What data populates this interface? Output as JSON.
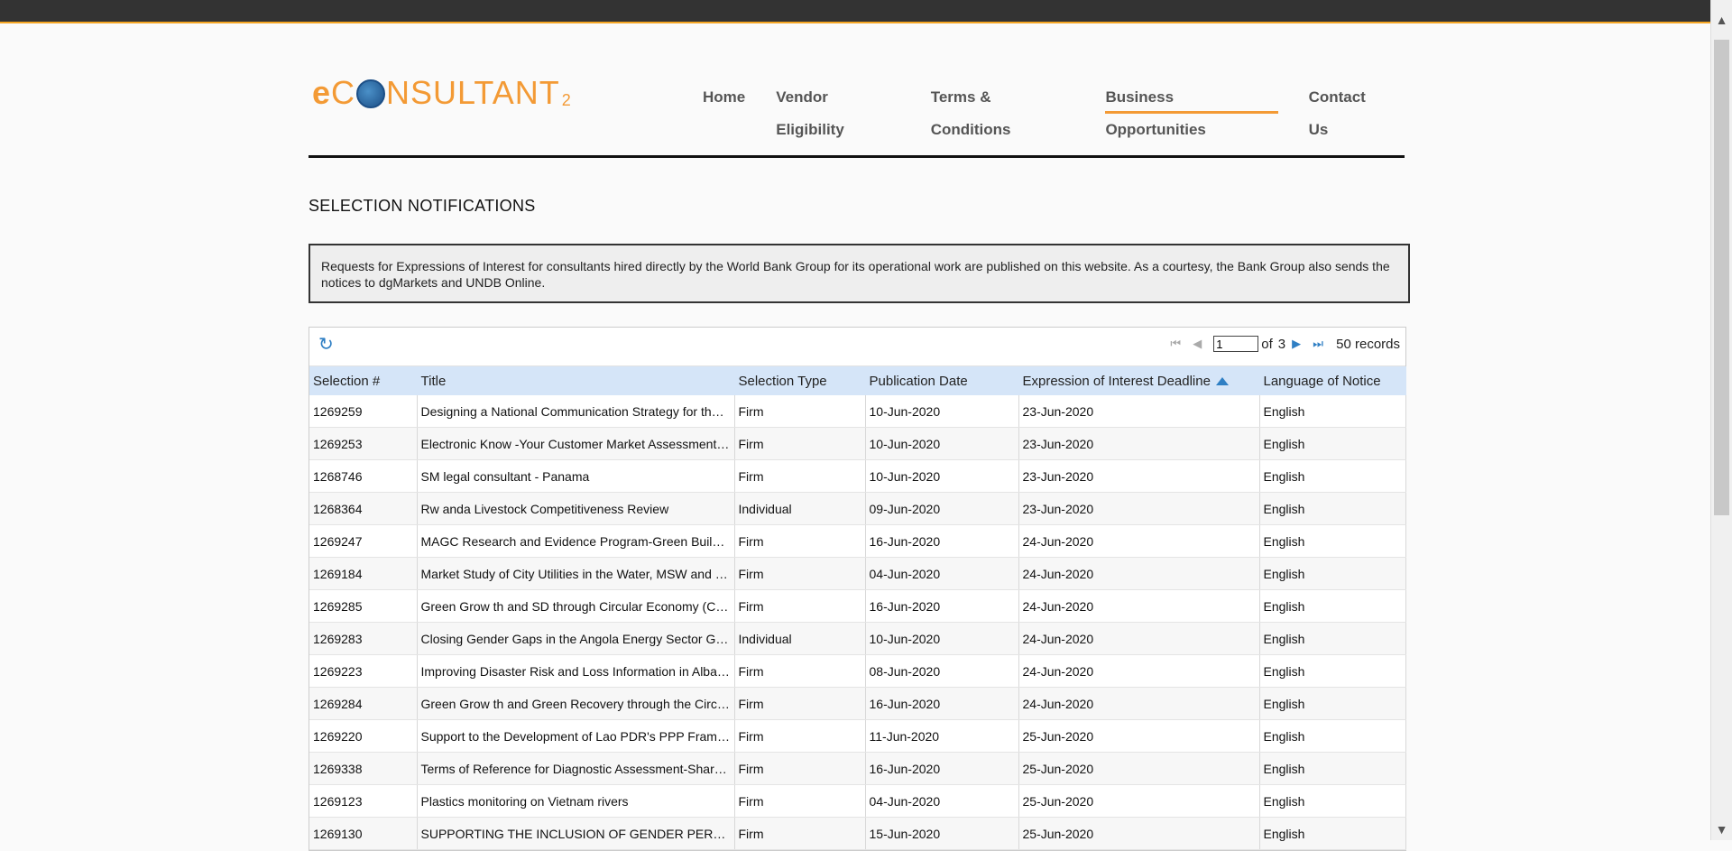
{
  "site": {
    "logo": {
      "e": "e",
      "c": "C",
      "rest": "NSULTANT",
      "sub": "2"
    }
  },
  "nav": {
    "items": [
      {
        "label": "Home"
      },
      {
        "label": "Vendor Eligibility"
      },
      {
        "label": "Terms & Conditions"
      },
      {
        "label": "Business Opportunities",
        "active": true
      },
      {
        "label": "Contact Us"
      }
    ]
  },
  "page": {
    "title": "SELECTION NOTIFICATIONS",
    "notice": "Requests for Expressions of Interest for consultants hired directly by the World Bank Group for its operational work are published on this website. As a courtesy, the Bank Group also sends the notices to dgMarkets and UNDB Online."
  },
  "pager": {
    "page_value": "1",
    "of_label": "of",
    "total_pages": "3",
    "records": "50 records"
  },
  "table": {
    "columns": [
      "Selection #",
      "Title",
      "Selection Type",
      "Publication Date",
      "Expression of Interest Deadline",
      "Language of Notice"
    ],
    "sort_column": "Expression of Interest Deadline",
    "rows": [
      [
        "1269259",
        "Designing a National Communication Strategy for the Go...",
        "Firm",
        "10-Jun-2020",
        "23-Jun-2020",
        "English"
      ],
      [
        "1269253",
        "Electronic Know -Your Customer Market Assessment - ...",
        "Firm",
        "10-Jun-2020",
        "23-Jun-2020",
        "English"
      ],
      [
        "1268746",
        "SM legal consultant - Panama",
        "Firm",
        "10-Jun-2020",
        "23-Jun-2020",
        "English"
      ],
      [
        "1268364",
        "Rw anda Livestock Competitiveness Review",
        "Individual",
        "09-Jun-2020",
        "23-Jun-2020",
        "English"
      ],
      [
        "1269247",
        "MAGC Research and Evidence Program-Green Building ...",
        "Firm",
        "16-Jun-2020",
        "24-Jun-2020",
        "English"
      ],
      [
        "1269184",
        "Market Study of City Utilities in the Water, MSW and Dist...",
        "Firm",
        "04-Jun-2020",
        "24-Jun-2020",
        "English"
      ],
      [
        "1269285",
        "Green Grow th and SD through Circular Economy (CE) i...",
        "Firm",
        "16-Jun-2020",
        "24-Jun-2020",
        "English"
      ],
      [
        "1269283",
        "Closing Gender Gaps in the Angola Energy Sector Gen...",
        "Individual",
        "10-Jun-2020",
        "24-Jun-2020",
        "English"
      ],
      [
        "1269223",
        "Improving Disaster Risk and Loss Information in Albania",
        "Firm",
        "08-Jun-2020",
        "24-Jun-2020",
        "English"
      ],
      [
        "1269284",
        "Green Grow th and Green Recovery through the Circula...",
        "Firm",
        "16-Jun-2020",
        "24-Jun-2020",
        "English"
      ],
      [
        "1269220",
        "Support to the Development of Lao PDR's PPP Framew o...",
        "Firm",
        "11-Jun-2020",
        "25-Jun-2020",
        "English"
      ],
      [
        "1269338",
        "Terms of Reference for Diagnostic Assessment-Share...",
        "Firm",
        "16-Jun-2020",
        "25-Jun-2020",
        "English"
      ],
      [
        "1269123",
        "Plastics monitoring on Vietnam rivers",
        "Firm",
        "04-Jun-2020",
        "25-Jun-2020",
        "English"
      ],
      [
        "1269130",
        "SUPPORTING THE INCLUSION OF GENDER PERSPECTIV...",
        "Firm",
        "15-Jun-2020",
        "25-Jun-2020",
        "English"
      ]
    ]
  }
}
